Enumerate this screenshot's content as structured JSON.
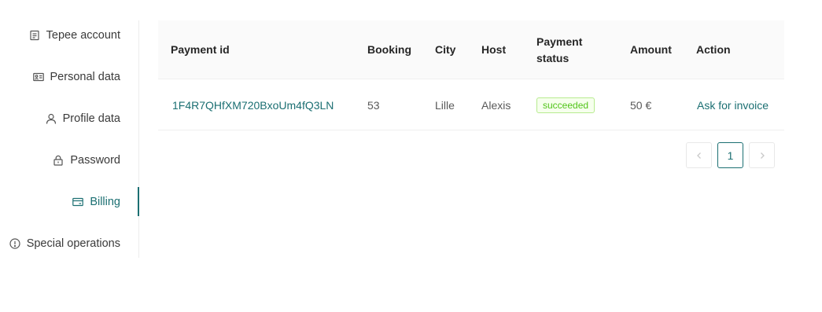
{
  "sidebar": {
    "items": [
      {
        "label": "Tepee account",
        "icon": "document-icon"
      },
      {
        "label": "Personal data",
        "icon": "id-card-icon"
      },
      {
        "label": "Profile data",
        "icon": "user-icon"
      },
      {
        "label": "Password",
        "icon": "lock-icon"
      },
      {
        "label": "Billing",
        "icon": "credit-card-icon",
        "active": true
      },
      {
        "label": "Special operations",
        "icon": "exclamation-circle-icon"
      }
    ]
  },
  "table": {
    "headers": {
      "payment_id": "Payment id",
      "booking": "Booking",
      "city": "City",
      "host": "Host",
      "payment_status_line1": "Payment",
      "payment_status_line2": "status",
      "amount": "Amount",
      "action": "Action"
    },
    "rows": [
      {
        "payment_id": "1F4R7QHfXM720BxoUm4fQ3LN",
        "booking": "53",
        "city": "Lille",
        "host": "Alexis",
        "status": "succeeded",
        "amount": "50 €",
        "action": "Ask for invoice"
      }
    ]
  },
  "pagination": {
    "current_page": "1"
  },
  "colors": {
    "accent": "#1b6f72",
    "success": "#52c41a"
  }
}
